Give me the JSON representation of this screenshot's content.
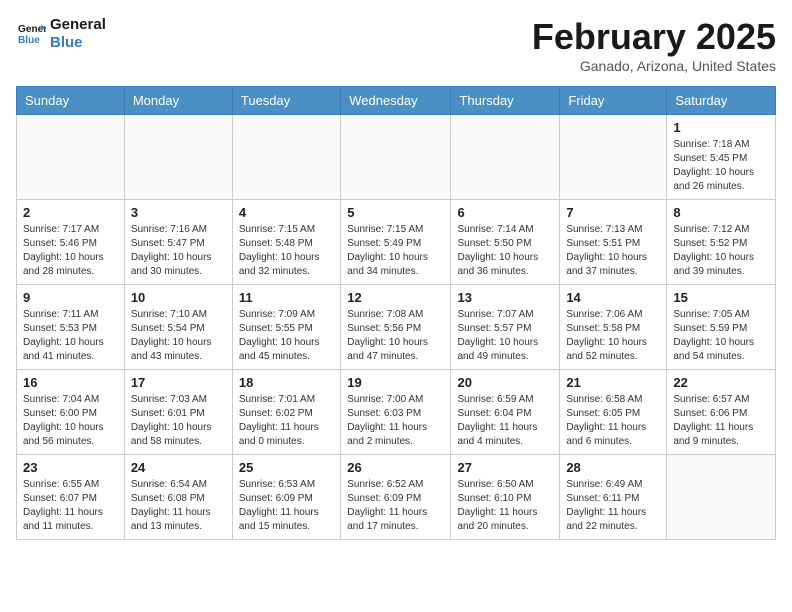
{
  "header": {
    "logo_line1": "General",
    "logo_line2": "Blue",
    "month_title": "February 2025",
    "location": "Ganado, Arizona, United States"
  },
  "calendar": {
    "days_of_week": [
      "Sunday",
      "Monday",
      "Tuesday",
      "Wednesday",
      "Thursday",
      "Friday",
      "Saturday"
    ],
    "weeks": [
      [
        {
          "day": "",
          "info": ""
        },
        {
          "day": "",
          "info": ""
        },
        {
          "day": "",
          "info": ""
        },
        {
          "day": "",
          "info": ""
        },
        {
          "day": "",
          "info": ""
        },
        {
          "day": "",
          "info": ""
        },
        {
          "day": "1",
          "info": "Sunrise: 7:18 AM\nSunset: 5:45 PM\nDaylight: 10 hours and 26 minutes."
        }
      ],
      [
        {
          "day": "2",
          "info": "Sunrise: 7:17 AM\nSunset: 5:46 PM\nDaylight: 10 hours and 28 minutes."
        },
        {
          "day": "3",
          "info": "Sunrise: 7:16 AM\nSunset: 5:47 PM\nDaylight: 10 hours and 30 minutes."
        },
        {
          "day": "4",
          "info": "Sunrise: 7:15 AM\nSunset: 5:48 PM\nDaylight: 10 hours and 32 minutes."
        },
        {
          "day": "5",
          "info": "Sunrise: 7:15 AM\nSunset: 5:49 PM\nDaylight: 10 hours and 34 minutes."
        },
        {
          "day": "6",
          "info": "Sunrise: 7:14 AM\nSunset: 5:50 PM\nDaylight: 10 hours and 36 minutes."
        },
        {
          "day": "7",
          "info": "Sunrise: 7:13 AM\nSunset: 5:51 PM\nDaylight: 10 hours and 37 minutes."
        },
        {
          "day": "8",
          "info": "Sunrise: 7:12 AM\nSunset: 5:52 PM\nDaylight: 10 hours and 39 minutes."
        }
      ],
      [
        {
          "day": "9",
          "info": "Sunrise: 7:11 AM\nSunset: 5:53 PM\nDaylight: 10 hours and 41 minutes."
        },
        {
          "day": "10",
          "info": "Sunrise: 7:10 AM\nSunset: 5:54 PM\nDaylight: 10 hours and 43 minutes."
        },
        {
          "day": "11",
          "info": "Sunrise: 7:09 AM\nSunset: 5:55 PM\nDaylight: 10 hours and 45 minutes."
        },
        {
          "day": "12",
          "info": "Sunrise: 7:08 AM\nSunset: 5:56 PM\nDaylight: 10 hours and 47 minutes."
        },
        {
          "day": "13",
          "info": "Sunrise: 7:07 AM\nSunset: 5:57 PM\nDaylight: 10 hours and 49 minutes."
        },
        {
          "day": "14",
          "info": "Sunrise: 7:06 AM\nSunset: 5:58 PM\nDaylight: 10 hours and 52 minutes."
        },
        {
          "day": "15",
          "info": "Sunrise: 7:05 AM\nSunset: 5:59 PM\nDaylight: 10 hours and 54 minutes."
        }
      ],
      [
        {
          "day": "16",
          "info": "Sunrise: 7:04 AM\nSunset: 6:00 PM\nDaylight: 10 hours and 56 minutes."
        },
        {
          "day": "17",
          "info": "Sunrise: 7:03 AM\nSunset: 6:01 PM\nDaylight: 10 hours and 58 minutes."
        },
        {
          "day": "18",
          "info": "Sunrise: 7:01 AM\nSunset: 6:02 PM\nDaylight: 11 hours and 0 minutes."
        },
        {
          "day": "19",
          "info": "Sunrise: 7:00 AM\nSunset: 6:03 PM\nDaylight: 11 hours and 2 minutes."
        },
        {
          "day": "20",
          "info": "Sunrise: 6:59 AM\nSunset: 6:04 PM\nDaylight: 11 hours and 4 minutes."
        },
        {
          "day": "21",
          "info": "Sunrise: 6:58 AM\nSunset: 6:05 PM\nDaylight: 11 hours and 6 minutes."
        },
        {
          "day": "22",
          "info": "Sunrise: 6:57 AM\nSunset: 6:06 PM\nDaylight: 11 hours and 9 minutes."
        }
      ],
      [
        {
          "day": "23",
          "info": "Sunrise: 6:55 AM\nSunset: 6:07 PM\nDaylight: 11 hours and 11 minutes."
        },
        {
          "day": "24",
          "info": "Sunrise: 6:54 AM\nSunset: 6:08 PM\nDaylight: 11 hours and 13 minutes."
        },
        {
          "day": "25",
          "info": "Sunrise: 6:53 AM\nSunset: 6:09 PM\nDaylight: 11 hours and 15 minutes."
        },
        {
          "day": "26",
          "info": "Sunrise: 6:52 AM\nSunset: 6:09 PM\nDaylight: 11 hours and 17 minutes."
        },
        {
          "day": "27",
          "info": "Sunrise: 6:50 AM\nSunset: 6:10 PM\nDaylight: 11 hours and 20 minutes."
        },
        {
          "day": "28",
          "info": "Sunrise: 6:49 AM\nSunset: 6:11 PM\nDaylight: 11 hours and 22 minutes."
        },
        {
          "day": "",
          "info": ""
        }
      ]
    ]
  }
}
